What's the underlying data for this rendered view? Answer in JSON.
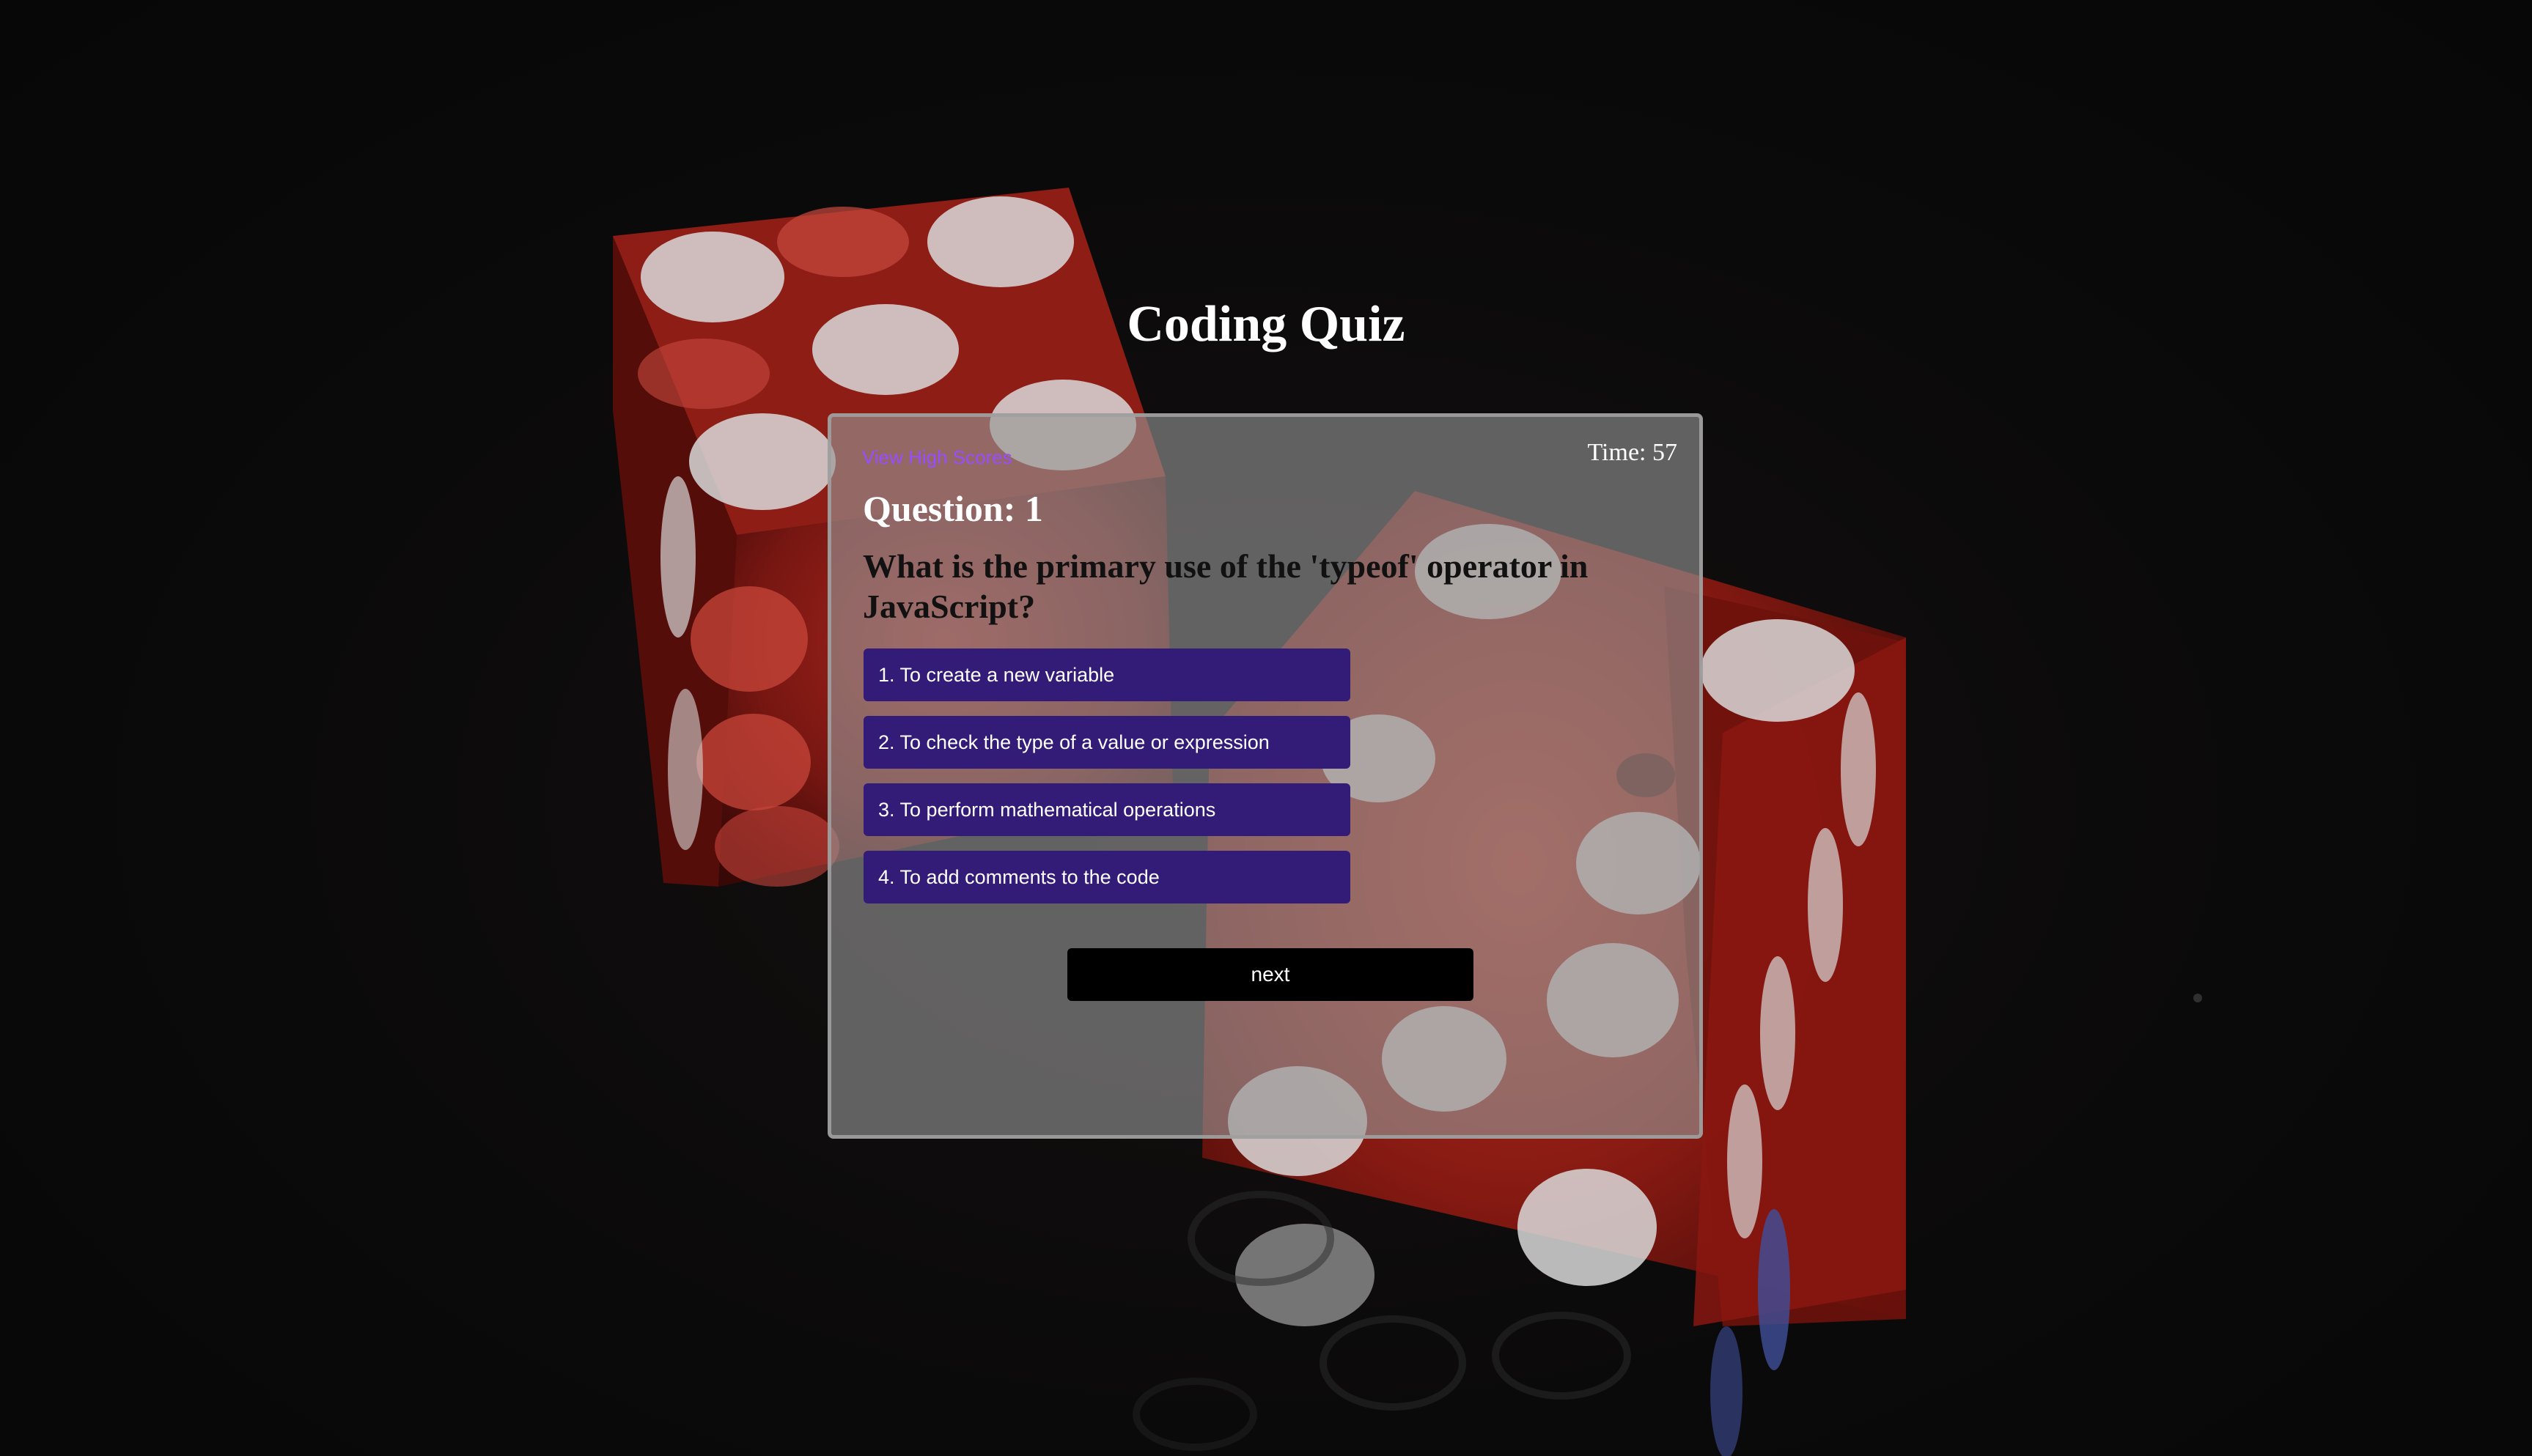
{
  "title": "Coding Quiz",
  "nav": {
    "high_scores_label": "View High Scores"
  },
  "timer": {
    "text": "Time: 57"
  },
  "question": {
    "number_label": "Question: 1",
    "text": "What is the primary use of the 'typeof' operator in JavaScript?",
    "answers": [
      "1. To create a new variable",
      "2. To check the type of a value or expression",
      "3. To perform mathematical operations",
      "4. To add comments to the code"
    ]
  },
  "controls": {
    "next_label": "next"
  },
  "colors": {
    "answer_button": "#331b78",
    "next_button": "#000000",
    "link": "#9a4dff",
    "card": "#969696"
  },
  "background": {
    "subject": "red-dice-icon"
  }
}
